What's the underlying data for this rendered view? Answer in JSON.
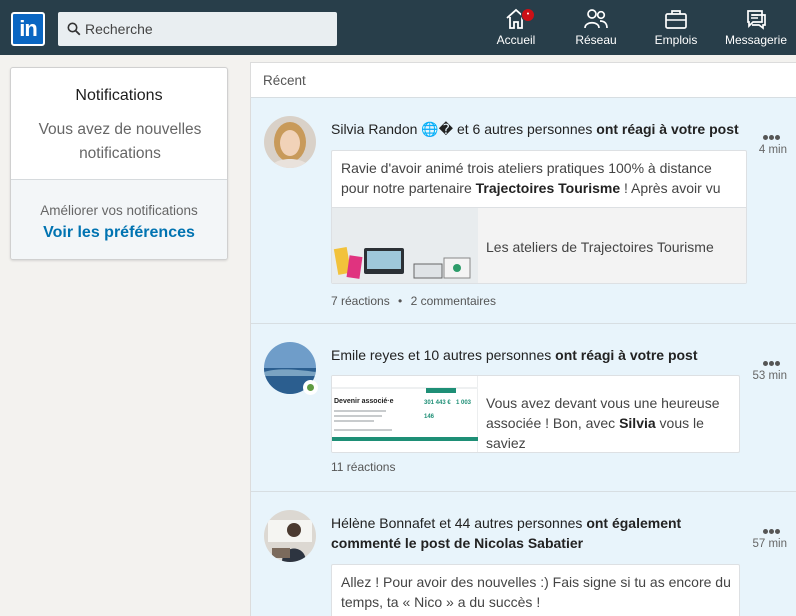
{
  "nav": {
    "logo": "in",
    "search_placeholder": "Recherche",
    "items": [
      {
        "label": "Accueil",
        "icon": "home-icon",
        "badge": "•"
      },
      {
        "label": "Réseau",
        "icon": "network-icon"
      },
      {
        "label": "Emplois",
        "icon": "jobs-icon"
      },
      {
        "label": "Messagerie",
        "icon": "messaging-icon"
      }
    ]
  },
  "sidebar": {
    "title": "Notifications",
    "subtitle": "Vous avez de nouvelles notifications",
    "improve": "Améliorer vos notifications",
    "preferences_link": "Voir les préférences"
  },
  "feed": {
    "section_label": "Récent",
    "notifications": [
      {
        "actor": "Silvia Randon",
        "actor_suffix": "🌐�",
        "others": " et 6 autres personnes ",
        "action": "ont réagi à votre post",
        "time": "4 min",
        "preview_text_before": "Ravie d'avoir animé trois ateliers pratiques 100% à distance pour notre partenaire ",
        "preview_bold": "Trajectoires Tourisme",
        "preview_text_after": " ! Après avoir vu",
        "link_title": "Les ateliers de Trajectoires Tourisme",
        "reactions": "7 réactions",
        "separator": "•",
        "comments": "2 commentaires"
      },
      {
        "actor": "Emile reyes",
        "others": " et 10 autres personnes ",
        "action": "ont réagi à votre post",
        "time": "53 min",
        "preview_text_before": "Vous avez devant vous une heureuse associée ! Bon, avec ",
        "preview_bold": "Silvia",
        "preview_text_after": " vous le saviez",
        "thumb_heading": "Devenir associé·e",
        "thumb_stat_1": "301 443 €",
        "thumb_stat_2": "1 003",
        "thumb_stat_3": "146",
        "reactions": "11 réactions"
      },
      {
        "actor": "Hélène Bonnafet",
        "others": " et 44 autres personnes ",
        "action": "ont également commenté le post de Nicolas Sabatier",
        "time": "57 min",
        "preview_text": "Allez ! Pour avoir des nouvelles :) Fais signe si tu as encore du temps, ta « Nico » a du succès !"
      }
    ]
  },
  "colors": {
    "topbar": "#283e4a",
    "brand": "#0a66c2",
    "link": "#0073b1",
    "unread_bg": "#e8f4fb",
    "online": "#5f9b41"
  }
}
